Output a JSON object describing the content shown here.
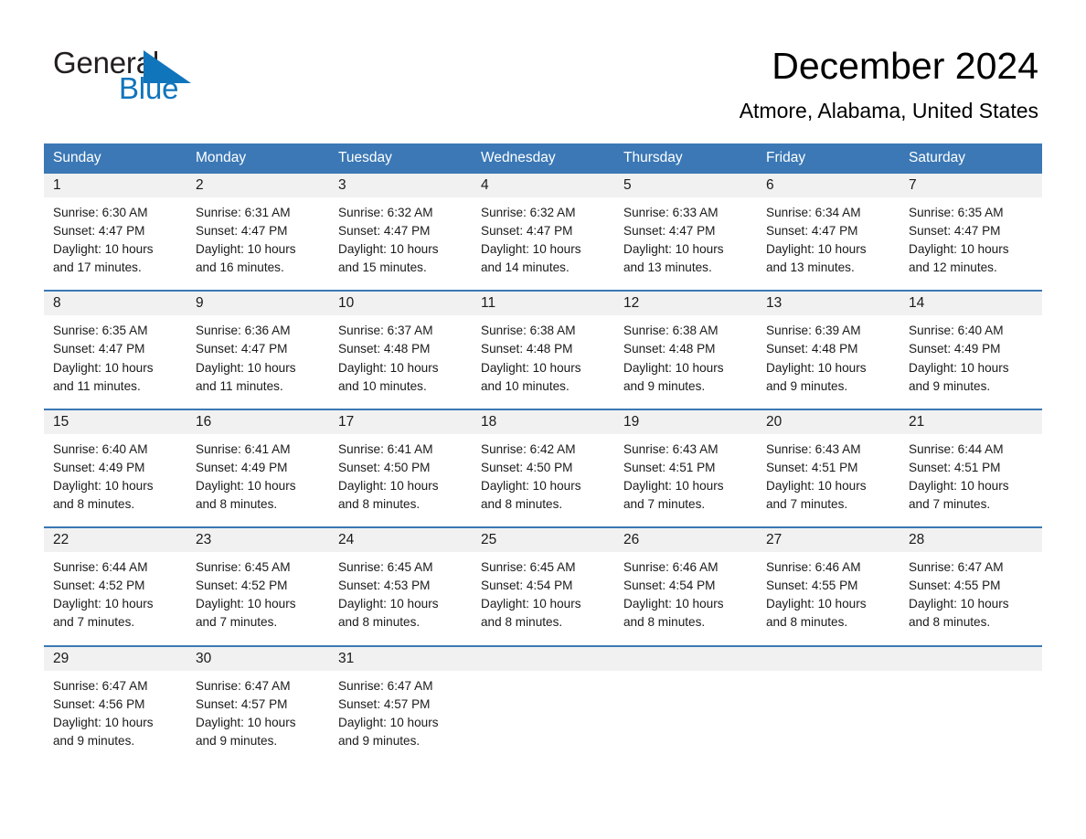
{
  "brand": {
    "name_part1": "General",
    "name_part2": "Blue",
    "triangle_color": "#1175bc",
    "text_color": "#231f20"
  },
  "header": {
    "title": "December 2024",
    "location": "Atmore, Alabama, United States"
  },
  "theme": {
    "header_bg": "#3b78b5",
    "header_text": "#ffffff",
    "daynum_bg": "#f1f1f1",
    "cell_bg": "#ffffff",
    "divider": "#3b78b5"
  },
  "weekdays": [
    "Sunday",
    "Monday",
    "Tuesday",
    "Wednesday",
    "Thursday",
    "Friday",
    "Saturday"
  ],
  "weeks": [
    [
      {
        "day": "1",
        "info": "Sunrise: 6:30 AM\nSunset: 4:47 PM\nDaylight: 10 hours\nand 17 minutes."
      },
      {
        "day": "2",
        "info": "Sunrise: 6:31 AM\nSunset: 4:47 PM\nDaylight: 10 hours\nand 16 minutes."
      },
      {
        "day": "3",
        "info": "Sunrise: 6:32 AM\nSunset: 4:47 PM\nDaylight: 10 hours\nand 15 minutes."
      },
      {
        "day": "4",
        "info": "Sunrise: 6:32 AM\nSunset: 4:47 PM\nDaylight: 10 hours\nand 14 minutes."
      },
      {
        "day": "5",
        "info": "Sunrise: 6:33 AM\nSunset: 4:47 PM\nDaylight: 10 hours\nand 13 minutes."
      },
      {
        "day": "6",
        "info": "Sunrise: 6:34 AM\nSunset: 4:47 PM\nDaylight: 10 hours\nand 13 minutes."
      },
      {
        "day": "7",
        "info": "Sunrise: 6:35 AM\nSunset: 4:47 PM\nDaylight: 10 hours\nand 12 minutes."
      }
    ],
    [
      {
        "day": "8",
        "info": "Sunrise: 6:35 AM\nSunset: 4:47 PM\nDaylight: 10 hours\nand 11 minutes."
      },
      {
        "day": "9",
        "info": "Sunrise: 6:36 AM\nSunset: 4:47 PM\nDaylight: 10 hours\nand 11 minutes."
      },
      {
        "day": "10",
        "info": "Sunrise: 6:37 AM\nSunset: 4:48 PM\nDaylight: 10 hours\nand 10 minutes."
      },
      {
        "day": "11",
        "info": "Sunrise: 6:38 AM\nSunset: 4:48 PM\nDaylight: 10 hours\nand 10 minutes."
      },
      {
        "day": "12",
        "info": "Sunrise: 6:38 AM\nSunset: 4:48 PM\nDaylight: 10 hours\nand 9 minutes."
      },
      {
        "day": "13",
        "info": "Sunrise: 6:39 AM\nSunset: 4:48 PM\nDaylight: 10 hours\nand 9 minutes."
      },
      {
        "day": "14",
        "info": "Sunrise: 6:40 AM\nSunset: 4:49 PM\nDaylight: 10 hours\nand 9 minutes."
      }
    ],
    [
      {
        "day": "15",
        "info": "Sunrise: 6:40 AM\nSunset: 4:49 PM\nDaylight: 10 hours\nand 8 minutes."
      },
      {
        "day": "16",
        "info": "Sunrise: 6:41 AM\nSunset: 4:49 PM\nDaylight: 10 hours\nand 8 minutes."
      },
      {
        "day": "17",
        "info": "Sunrise: 6:41 AM\nSunset: 4:50 PM\nDaylight: 10 hours\nand 8 minutes."
      },
      {
        "day": "18",
        "info": "Sunrise: 6:42 AM\nSunset: 4:50 PM\nDaylight: 10 hours\nand 8 minutes."
      },
      {
        "day": "19",
        "info": "Sunrise: 6:43 AM\nSunset: 4:51 PM\nDaylight: 10 hours\nand 7 minutes."
      },
      {
        "day": "20",
        "info": "Sunrise: 6:43 AM\nSunset: 4:51 PM\nDaylight: 10 hours\nand 7 minutes."
      },
      {
        "day": "21",
        "info": "Sunrise: 6:44 AM\nSunset: 4:51 PM\nDaylight: 10 hours\nand 7 minutes."
      }
    ],
    [
      {
        "day": "22",
        "info": "Sunrise: 6:44 AM\nSunset: 4:52 PM\nDaylight: 10 hours\nand 7 minutes."
      },
      {
        "day": "23",
        "info": "Sunrise: 6:45 AM\nSunset: 4:52 PM\nDaylight: 10 hours\nand 7 minutes."
      },
      {
        "day": "24",
        "info": "Sunrise: 6:45 AM\nSunset: 4:53 PM\nDaylight: 10 hours\nand 8 minutes."
      },
      {
        "day": "25",
        "info": "Sunrise: 6:45 AM\nSunset: 4:54 PM\nDaylight: 10 hours\nand 8 minutes."
      },
      {
        "day": "26",
        "info": "Sunrise: 6:46 AM\nSunset: 4:54 PM\nDaylight: 10 hours\nand 8 minutes."
      },
      {
        "day": "27",
        "info": "Sunrise: 6:46 AM\nSunset: 4:55 PM\nDaylight: 10 hours\nand 8 minutes."
      },
      {
        "day": "28",
        "info": "Sunrise: 6:47 AM\nSunset: 4:55 PM\nDaylight: 10 hours\nand 8 minutes."
      }
    ],
    [
      {
        "day": "29",
        "info": "Sunrise: 6:47 AM\nSunset: 4:56 PM\nDaylight: 10 hours\nand 9 minutes."
      },
      {
        "day": "30",
        "info": "Sunrise: 6:47 AM\nSunset: 4:57 PM\nDaylight: 10 hours\nand 9 minutes."
      },
      {
        "day": "31",
        "info": "Sunrise: 6:47 AM\nSunset: 4:57 PM\nDaylight: 10 hours\nand 9 minutes."
      },
      {
        "day": "",
        "info": ""
      },
      {
        "day": "",
        "info": ""
      },
      {
        "day": "",
        "info": ""
      },
      {
        "day": "",
        "info": ""
      }
    ]
  ]
}
